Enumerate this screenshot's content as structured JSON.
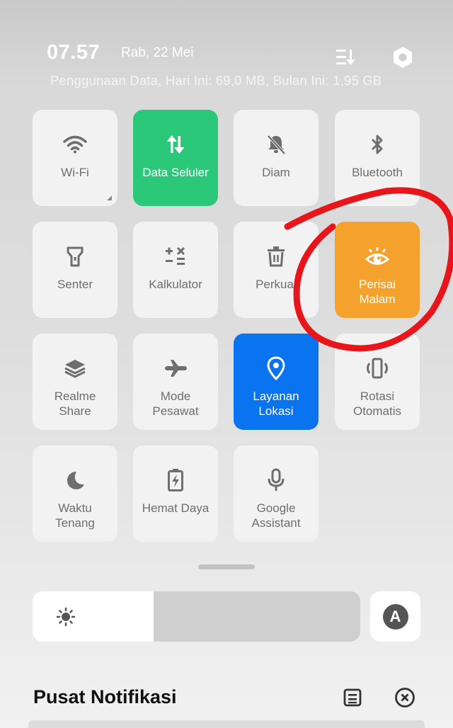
{
  "header": {
    "time": "07.57",
    "date": "Rab, 22 Mei",
    "data_usage": "Penggunaan Data, Hari Ini: 69,0 MB, Bulan Ini: 1,95 GB",
    "edit_icon": "edit-sort-icon",
    "settings_icon": "settings-hexagon-icon"
  },
  "tiles": [
    {
      "label": "Wi-Fi",
      "icon": "wifi-icon",
      "state": "off"
    },
    {
      "label": "Data Seluler",
      "icon": "mobile-data-icon",
      "state": "on",
      "color": "#2ac878"
    },
    {
      "label": "Diam",
      "icon": "bell-off-icon",
      "state": "off"
    },
    {
      "label": "Bluetooth",
      "icon": "bluetooth-icon",
      "state": "off"
    },
    {
      "label": "Senter",
      "icon": "flashlight-icon",
      "state": "off"
    },
    {
      "label": "Kalkulator",
      "icon": "calculator-icon",
      "state": "off"
    },
    {
      "label": "Perkua",
      "icon": "trash-icon",
      "state": "off"
    },
    {
      "label": "Perisai Malam",
      "icon": "eye-icon",
      "state": "on",
      "color": "#f5a12d"
    },
    {
      "label": "Realme Share",
      "icon": "realme-share-icon",
      "state": "off"
    },
    {
      "label": "Mode Pesawat",
      "icon": "airplane-icon",
      "state": "off"
    },
    {
      "label": "Layanan Lokasi",
      "icon": "location-icon",
      "state": "on",
      "color": "#0a73f0"
    },
    {
      "label": "Rotasi Otomatis",
      "icon": "rotate-icon",
      "state": "off"
    },
    {
      "label": "Waktu Tenang",
      "icon": "moon-icon",
      "state": "off"
    },
    {
      "label": "Hemat Daya",
      "icon": "battery-saver-icon",
      "state": "off"
    },
    {
      "label": "Google Assistant",
      "icon": "microphone-icon",
      "state": "off"
    }
  ],
  "brightness": {
    "level": 0.37,
    "icon": "sun-icon"
  },
  "auto_brightness": {
    "label": "A"
  },
  "notifications": {
    "title": "Pusat Notifikasi",
    "manage_icon": "notification-manage-icon",
    "clear_icon": "clear-all-icon"
  },
  "annotation": {
    "shape": "red-circle",
    "color": "#e8151b",
    "target": "Perisai Malam"
  }
}
